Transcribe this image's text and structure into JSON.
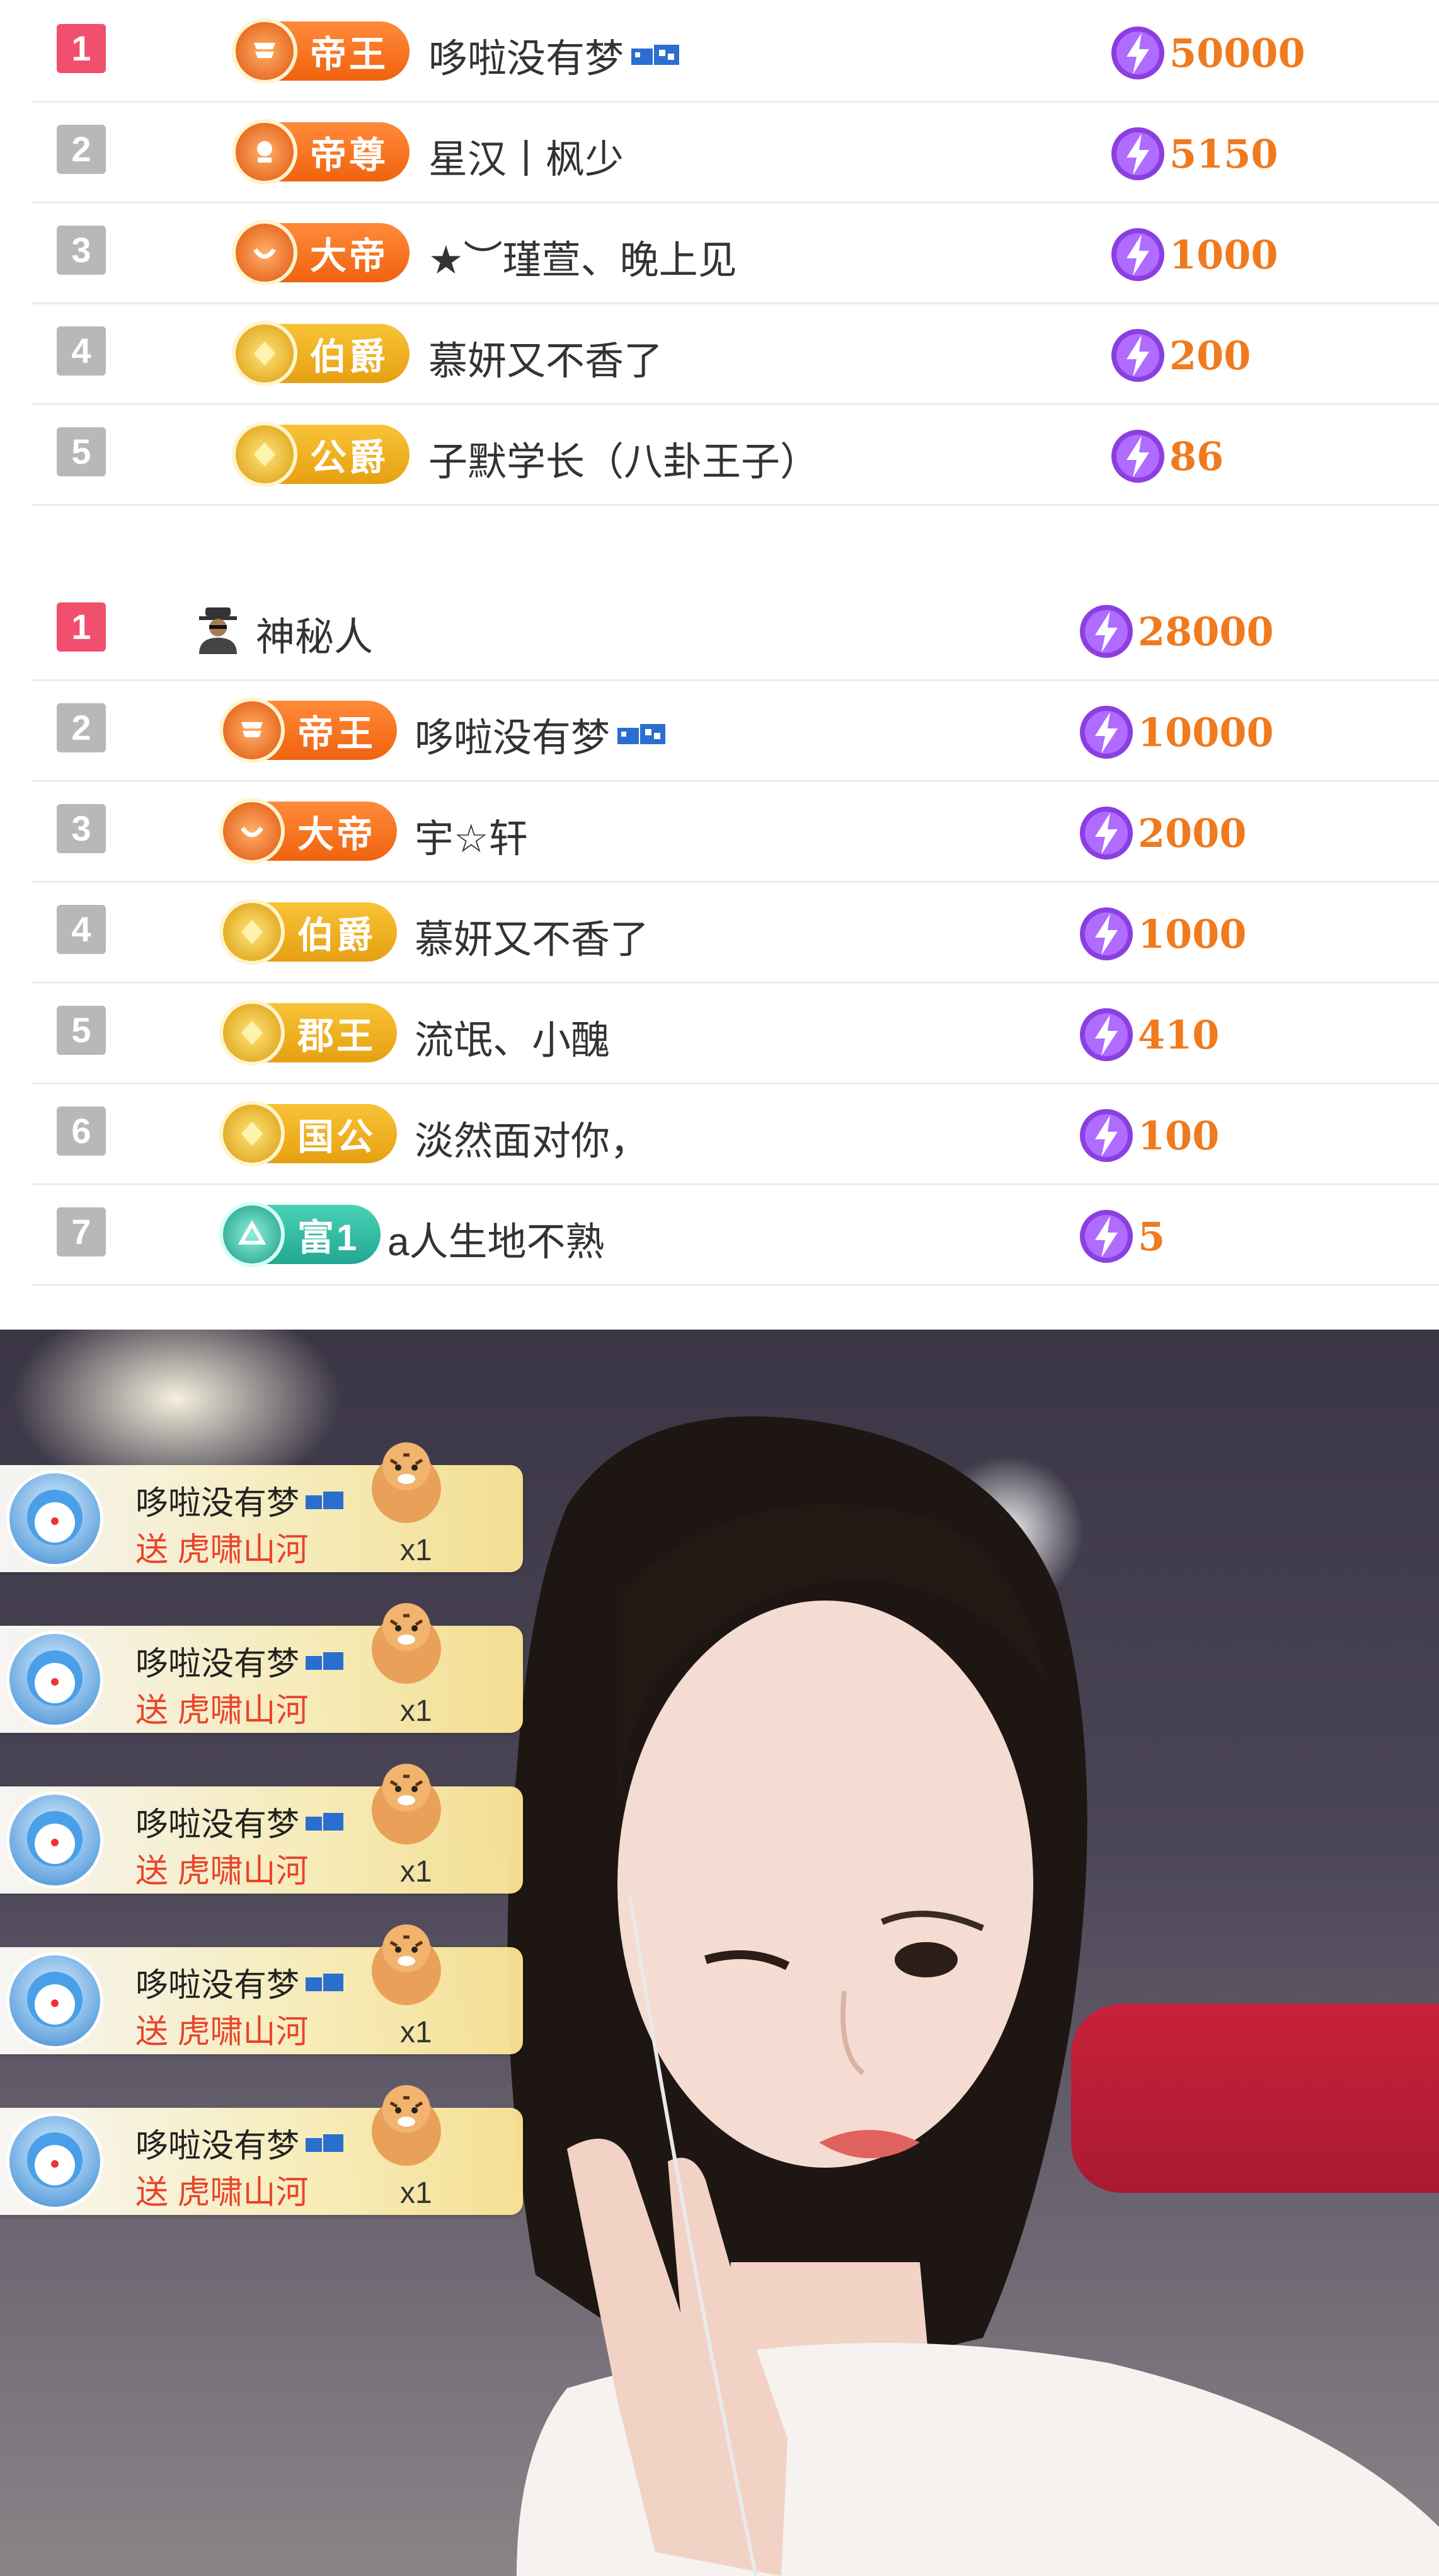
{
  "board1": {
    "rows": [
      {
        "rank": "1",
        "badge": "帝王",
        "name": "哆啦没有梦",
        "vip": true,
        "score": "50000"
      },
      {
        "rank": "2",
        "badge": "帝尊",
        "name": "星汉丨枫少",
        "vip": false,
        "score": "5150"
      },
      {
        "rank": "3",
        "badge": "大帝",
        "name": "★︶瑾萱、晚上见",
        "vip": false,
        "score": "1000"
      },
      {
        "rank": "4",
        "badge": "伯爵",
        "name": "慕妍又不香了",
        "vip": false,
        "score": "200"
      },
      {
        "rank": "5",
        "badge": "公爵",
        "name": "子默学长（八卦王子）",
        "vip": false,
        "score": "86"
      }
    ]
  },
  "board2": {
    "rows": [
      {
        "rank": "1",
        "badge": "",
        "name": "神秘人",
        "vip": false,
        "score": "28000"
      },
      {
        "rank": "2",
        "badge": "帝王",
        "name": "哆啦没有梦",
        "vip": true,
        "score": "10000"
      },
      {
        "rank": "3",
        "badge": "大帝",
        "name": "宇☆轩",
        "vip": false,
        "score": "2000"
      },
      {
        "rank": "4",
        "badge": "伯爵",
        "name": "慕妍又不香了",
        "vip": false,
        "score": "1000"
      },
      {
        "rank": "5",
        "badge": "郡王",
        "name": "流氓、小醜",
        "vip": false,
        "score": "410"
      },
      {
        "rank": "6",
        "badge": "国公",
        "name": "淡然面对你，",
        "vip": false,
        "score": "100"
      },
      {
        "rank": "7",
        "badge": "富1",
        "name": "a人生地不熟",
        "vip": false,
        "score": "5"
      }
    ]
  },
  "gifts": [
    {
      "sender": "哆啦没有梦",
      "action": "送 虎啸山河",
      "count": "x1"
    },
    {
      "sender": "哆啦没有梦",
      "action": "送 虎啸山河",
      "count": "x1"
    },
    {
      "sender": "哆啦没有梦",
      "action": "送 虎啸山河",
      "count": "x1"
    },
    {
      "sender": "哆啦没有梦",
      "action": "送 虎啸山河",
      "count": "x1"
    },
    {
      "sender": "哆啦没有梦",
      "action": "送 虎啸山河",
      "count": "x1"
    }
  ],
  "colors": {
    "rank_top": "#f0506e",
    "rank_normal": "#b8b8b8",
    "score": "#f07a1e",
    "gift_action": "#e8442a"
  },
  "icons": [
    "lightning-bolt-icon",
    "vip-level-icon",
    "mystery-user-icon",
    "noble-badge-icon",
    "tiger-gift-icon",
    "user-avatar-icon"
  ]
}
